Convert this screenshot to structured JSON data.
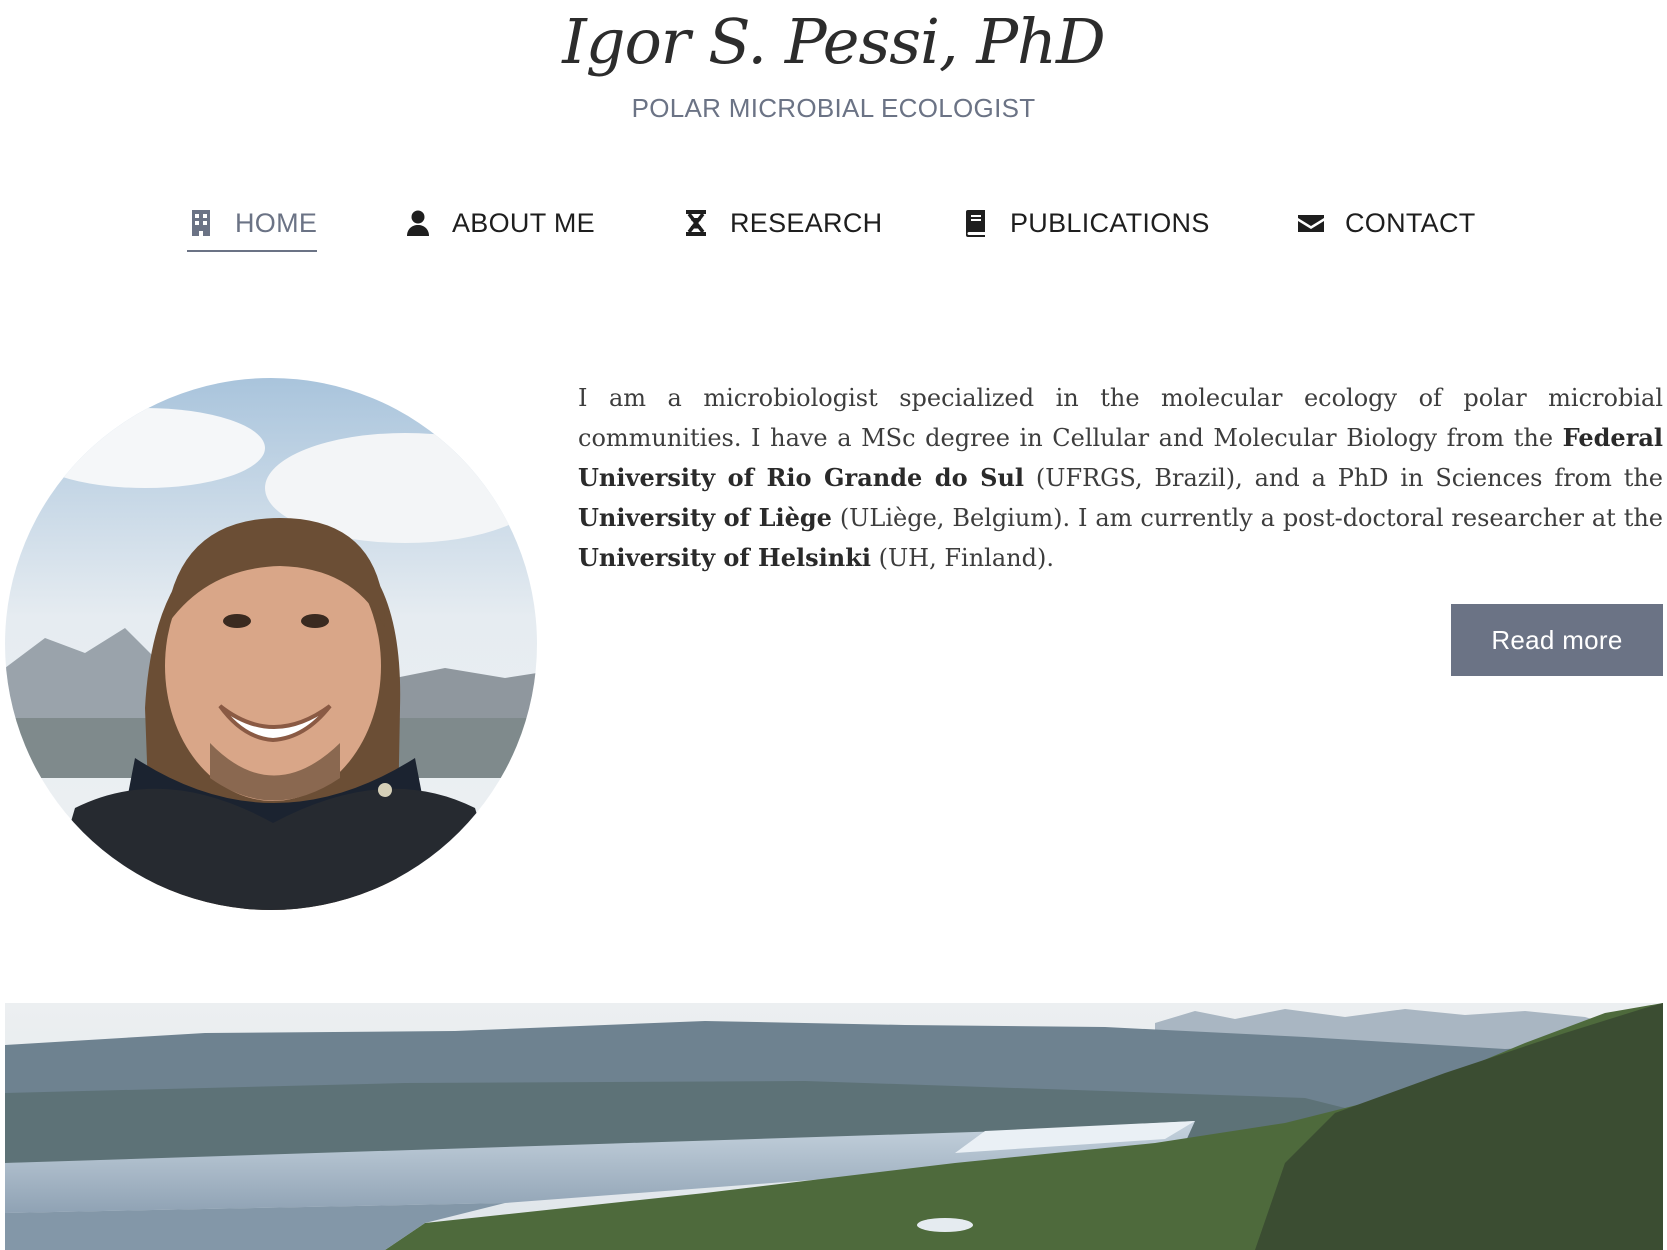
{
  "header": {
    "title": "Igor S. Pessi, PhD",
    "subtitle": "POLAR MICROBIAL ECOLOGIST"
  },
  "nav": {
    "items": [
      {
        "label": "HOME",
        "icon": "building-icon",
        "active": true
      },
      {
        "label": "ABOUT ME",
        "icon": "user-icon",
        "active": false
      },
      {
        "label": "RESEARCH",
        "icon": "dna-icon",
        "active": false
      },
      {
        "label": "PUBLICATIONS",
        "icon": "book-icon",
        "active": false
      },
      {
        "label": "CONTACT",
        "icon": "envelope-icon",
        "active": false
      }
    ]
  },
  "intro": {
    "text_1": "I am a microbiologist specialized in the molecular ecology of polar microbial communities. I have a MSc degree in Cellular and Molecular Biology from the ",
    "bold_1": "Federal University of Rio Grande do Sul",
    "text_2": " (UFRGS, Brazil), and a PhD in Sciences from the ",
    "bold_2": "University of Liège",
    "text_3": " (ULiège, Belgium). I am currently a post-doctoral researcher at the ",
    "bold_3": "University of Helsinki",
    "text_4": " (UH, Finland).",
    "button_label": "Read more"
  },
  "colors": {
    "accent": "#6b7385",
    "text": "#3d3d3d",
    "button_text": "#ffffff"
  }
}
